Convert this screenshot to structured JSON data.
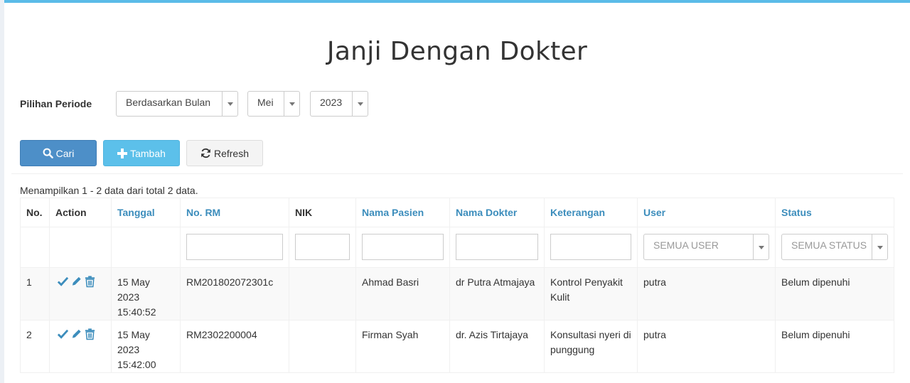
{
  "page": {
    "title": "Janji Dengan Dokter"
  },
  "period": {
    "label": "Pilihan Periode",
    "mode": "Berdasarkan Bulan",
    "month": "Mei",
    "year": "2023"
  },
  "buttons": {
    "cari": "Cari",
    "tambah": "Tambah",
    "refresh": "Refresh"
  },
  "summary": "Menampilkan 1 - 2 data dari total 2 data.",
  "table": {
    "headers": {
      "no": "No.",
      "action": "Action",
      "tanggal": "Tanggal",
      "no_rm": "No. RM",
      "nik": "NIK",
      "nama_pasien": "Nama Pasien",
      "nama_dokter": "Nama Dokter",
      "keterangan": "Keterangan",
      "user": "User",
      "status": "Status"
    },
    "filters": {
      "user_placeholder": "SEMUA USER",
      "status_placeholder": "SEMUA STATUS"
    },
    "rows": [
      {
        "no": "1",
        "tanggal_date": "15 May 2023",
        "tanggal_time": "15:40:52",
        "no_rm": "RM201802072301c",
        "nik": "",
        "nama_pasien": "Ahmad Basri",
        "nama_dokter": "dr Putra Atmajaya",
        "keterangan": "Kontrol Penyakit Kulit",
        "user": "putra",
        "status": "Belum dipenuhi"
      },
      {
        "no": "2",
        "tanggal_date": "15 May 2023",
        "tanggal_time": "15:42:00",
        "no_rm": "RM2302200004",
        "nik": "",
        "nama_pasien": "Firman Syah",
        "nama_dokter": "dr. Azis Tirtajaya",
        "keterangan": "Konsultasi nyeri di punggung",
        "user": "putra",
        "status": "Belum dipenuhi"
      }
    ]
  },
  "icons": {
    "search": "search-icon",
    "plus": "plus-icon",
    "refresh": "refresh-icon",
    "check": "check-icon",
    "edit": "pencil-icon",
    "delete": "trash-icon"
  },
  "colors": {
    "primary": "#4d8fc8",
    "info": "#5cc0ea",
    "link": "#3c8dbc",
    "top_border": "#5bbbe8"
  }
}
